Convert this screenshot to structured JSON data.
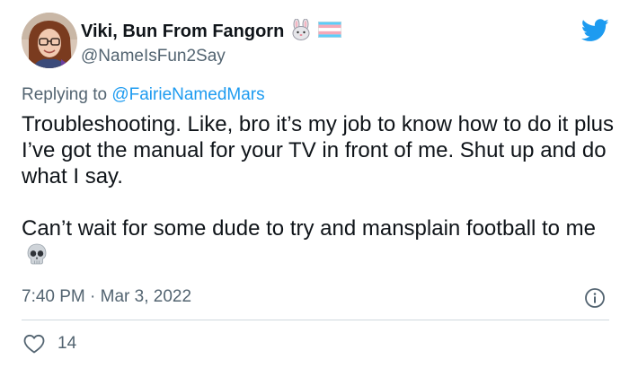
{
  "author": {
    "display_name": "Viki, Bun From Fangorn",
    "handle": "@NameIsFun2Say",
    "badges": [
      "rabbit-emoji",
      "transgender-flag-emoji"
    ]
  },
  "reply": {
    "prefix": "Replying to",
    "mention": "@FairieNamedMars"
  },
  "tweet": {
    "line1": "Troubleshooting. Like, bro it’s my job to know how to do it plus I’ve got the manual for your TV in front of me. Shut up and do what I say.",
    "line2": "Can’t wait for some dude to try and mansplain football to me",
    "trailing_emoji": "skull-emoji"
  },
  "meta": {
    "time": "7:40 PM",
    "separator": "·",
    "date": "Mar 3, 2022"
  },
  "engagement": {
    "likes": "14"
  },
  "colors": {
    "text": "#0f1419",
    "secondary": "#536471",
    "accent": "#1d9bf0",
    "divider": "#cfd9de"
  },
  "icons": [
    "avatar",
    "twitter-bird-icon",
    "info-icon",
    "heart-icon"
  ]
}
